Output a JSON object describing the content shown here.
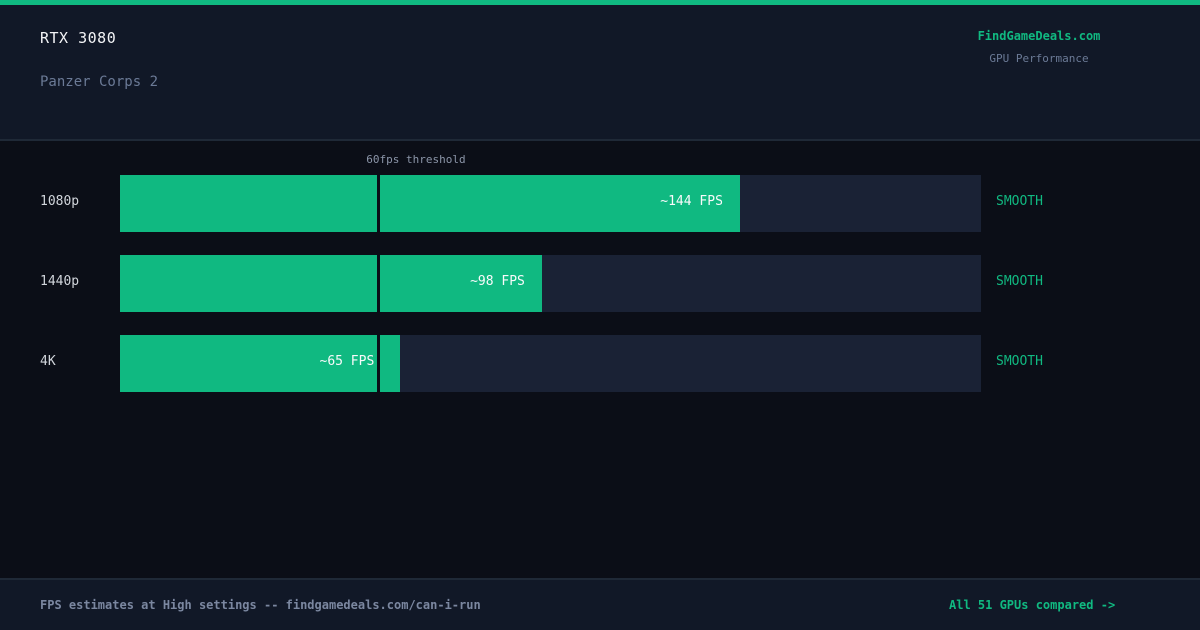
{
  "header": {
    "gpu": "RTX 3080",
    "game": "Panzer Corps 2",
    "brand": "FindGameDeals.com",
    "brand_sub": "GPU Performance"
  },
  "chart_data": {
    "type": "bar",
    "orientation": "horizontal",
    "categories": [
      "1080p",
      "1440p",
      "4K"
    ],
    "values": [
      144,
      98,
      65
    ],
    "value_labels": [
      "~144 FPS",
      "~98 FPS",
      "~65 FPS"
    ],
    "status_labels": [
      "SMOOTH",
      "SMOOTH",
      "SMOOTH"
    ],
    "xlim": [
      0,
      200
    ],
    "threshold": {
      "value": 60,
      "label": "60fps threshold"
    },
    "grid": false,
    "colors": {
      "bar": "#10b981",
      "track": "#1a2235",
      "status": "#10b981"
    }
  },
  "footer": {
    "note": "FPS estimates at High settings -- findgamedeals.com/can-i-run",
    "link": "All 51 GPUs compared ->"
  }
}
